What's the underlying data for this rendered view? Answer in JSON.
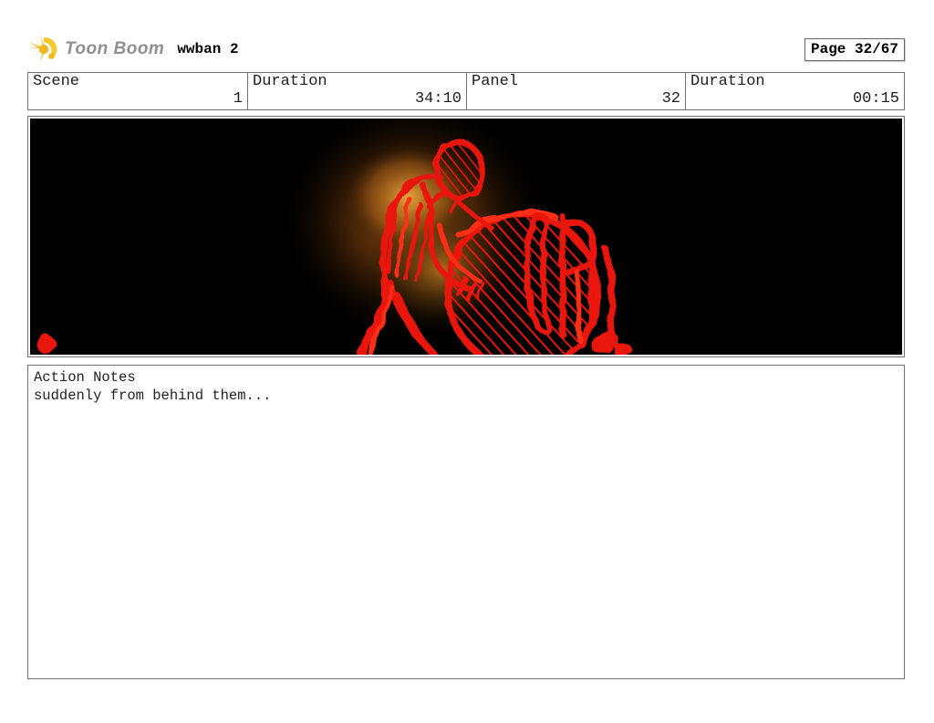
{
  "header": {
    "brand": "Toon Boom",
    "project_title": "wwban 2",
    "page_badge": "Page 32/67",
    "logo_icon": "toonboom-starburst-icon",
    "logo_color": "#f0b81e"
  },
  "info_table": {
    "cells": [
      {
        "label": "Scene",
        "value": "1"
      },
      {
        "label": "Duration",
        "value": "34:10"
      },
      {
        "label": "Panel",
        "value": "32"
      },
      {
        "label": "Duration",
        "value": "00:15"
      }
    ]
  },
  "storyboard_panel": {
    "background": "#000000",
    "sketch_color": "#e8150a",
    "glow_color": "#c87c22",
    "content": "red chalk sketch of a figure leaning over a large hatched boulder, lit by an orange glow"
  },
  "action_notes": {
    "title": "Action Notes",
    "body": "suddenly from behind them..."
  }
}
